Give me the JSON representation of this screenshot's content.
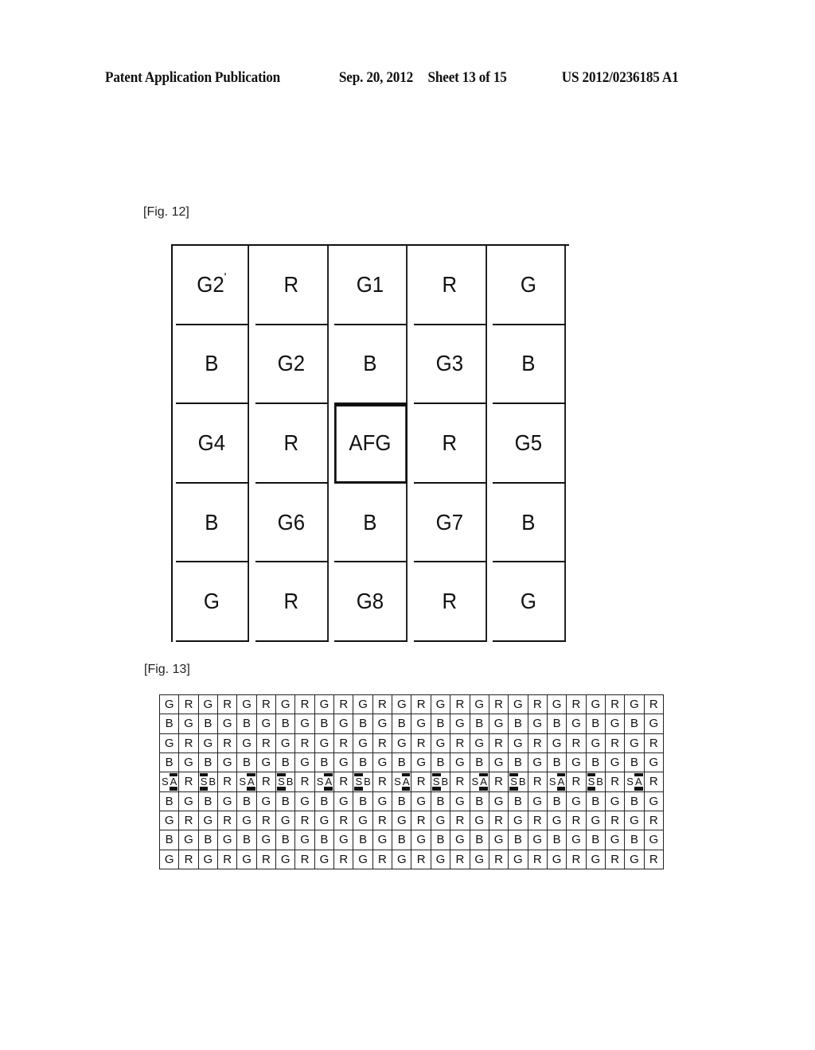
{
  "header": {
    "publication_label": "Patent Application Publication",
    "date": "Sep. 20, 2012",
    "sheet": "Sheet 13 of 15",
    "patent_number": "US 2012/0236185 A1"
  },
  "figures": {
    "fig12": {
      "label": "[Fig. 12]",
      "highlighted_cell": "AFG",
      "rows": [
        [
          "G2'",
          "R",
          "G1",
          "R",
          "G"
        ],
        [
          "B",
          "G2",
          "B",
          "G3",
          "B"
        ],
        [
          "G4",
          "R",
          "AFG",
          "R",
          "G5"
        ],
        [
          "B",
          "G6",
          "B",
          "G7",
          "B"
        ],
        [
          "G",
          "R",
          "G8",
          "R",
          "G"
        ]
      ]
    },
    "fig13": {
      "label": "[Fig. 13]",
      "columns": 26,
      "highlight_color": "#111111",
      "rows": [
        [
          "G",
          "R",
          "G",
          "R",
          "G",
          "R",
          "G",
          "R",
          "G",
          "R",
          "G",
          "R",
          "G",
          "R",
          "G",
          "R",
          "G",
          "R",
          "G",
          "R",
          "G",
          "R",
          "G",
          "R",
          "G",
          "R"
        ],
        [
          "B",
          "G",
          "B",
          "G",
          "B",
          "G",
          "B",
          "G",
          "B",
          "G",
          "B",
          "G",
          "B",
          "G",
          "B",
          "G",
          "B",
          "G",
          "B",
          "G",
          "B",
          "G",
          "B",
          "G",
          "B",
          "G"
        ],
        [
          "G",
          "R",
          "G",
          "R",
          "G",
          "R",
          "G",
          "R",
          "G",
          "R",
          "G",
          "R",
          "G",
          "R",
          "G",
          "R",
          "G",
          "R",
          "G",
          "R",
          "G",
          "R",
          "G",
          "R",
          "G",
          "R"
        ],
        [
          "B",
          "G",
          "B",
          "G",
          "B",
          "G",
          "B",
          "G",
          "B",
          "G",
          "B",
          "G",
          "B",
          "G",
          "B",
          "G",
          "B",
          "G",
          "B",
          "G",
          "B",
          "G",
          "B",
          "G",
          "B",
          "G"
        ],
        [
          "SA",
          "R",
          "SB",
          "R",
          "SA",
          "R",
          "SB",
          "R",
          "SA",
          "R",
          "SB",
          "R",
          "SA",
          "R",
          "SB",
          "R",
          "SA",
          "R",
          "SB",
          "R",
          "SA",
          "R",
          "SB",
          "R",
          "SA",
          "R"
        ],
        [
          "B",
          "G",
          "B",
          "G",
          "B",
          "G",
          "B",
          "G",
          "B",
          "G",
          "B",
          "G",
          "B",
          "G",
          "B",
          "G",
          "B",
          "G",
          "B",
          "G",
          "B",
          "G",
          "B",
          "G",
          "B",
          "G"
        ],
        [
          "G",
          "R",
          "G",
          "R",
          "G",
          "R",
          "G",
          "R",
          "G",
          "R",
          "G",
          "R",
          "G",
          "R",
          "G",
          "R",
          "G",
          "R",
          "G",
          "R",
          "G",
          "R",
          "G",
          "R",
          "G",
          "R"
        ],
        [
          "B",
          "G",
          "B",
          "G",
          "B",
          "G",
          "B",
          "G",
          "B",
          "G",
          "B",
          "G",
          "B",
          "G",
          "B",
          "G",
          "B",
          "G",
          "B",
          "G",
          "B",
          "G",
          "B",
          "G",
          "B",
          "G"
        ],
        [
          "G",
          "R",
          "G",
          "R",
          "G",
          "R",
          "G",
          "R",
          "G",
          "R",
          "G",
          "R",
          "G",
          "R",
          "G",
          "R",
          "G",
          "R",
          "G",
          "R",
          "G",
          "R",
          "G",
          "R",
          "G",
          "R"
        ]
      ],
      "pair_cells": {
        "SA": {
          "left": "S",
          "right": "A",
          "highlighted": "right"
        },
        "SB": {
          "left": "S",
          "right": "B",
          "highlighted": "left"
        }
      }
    }
  }
}
